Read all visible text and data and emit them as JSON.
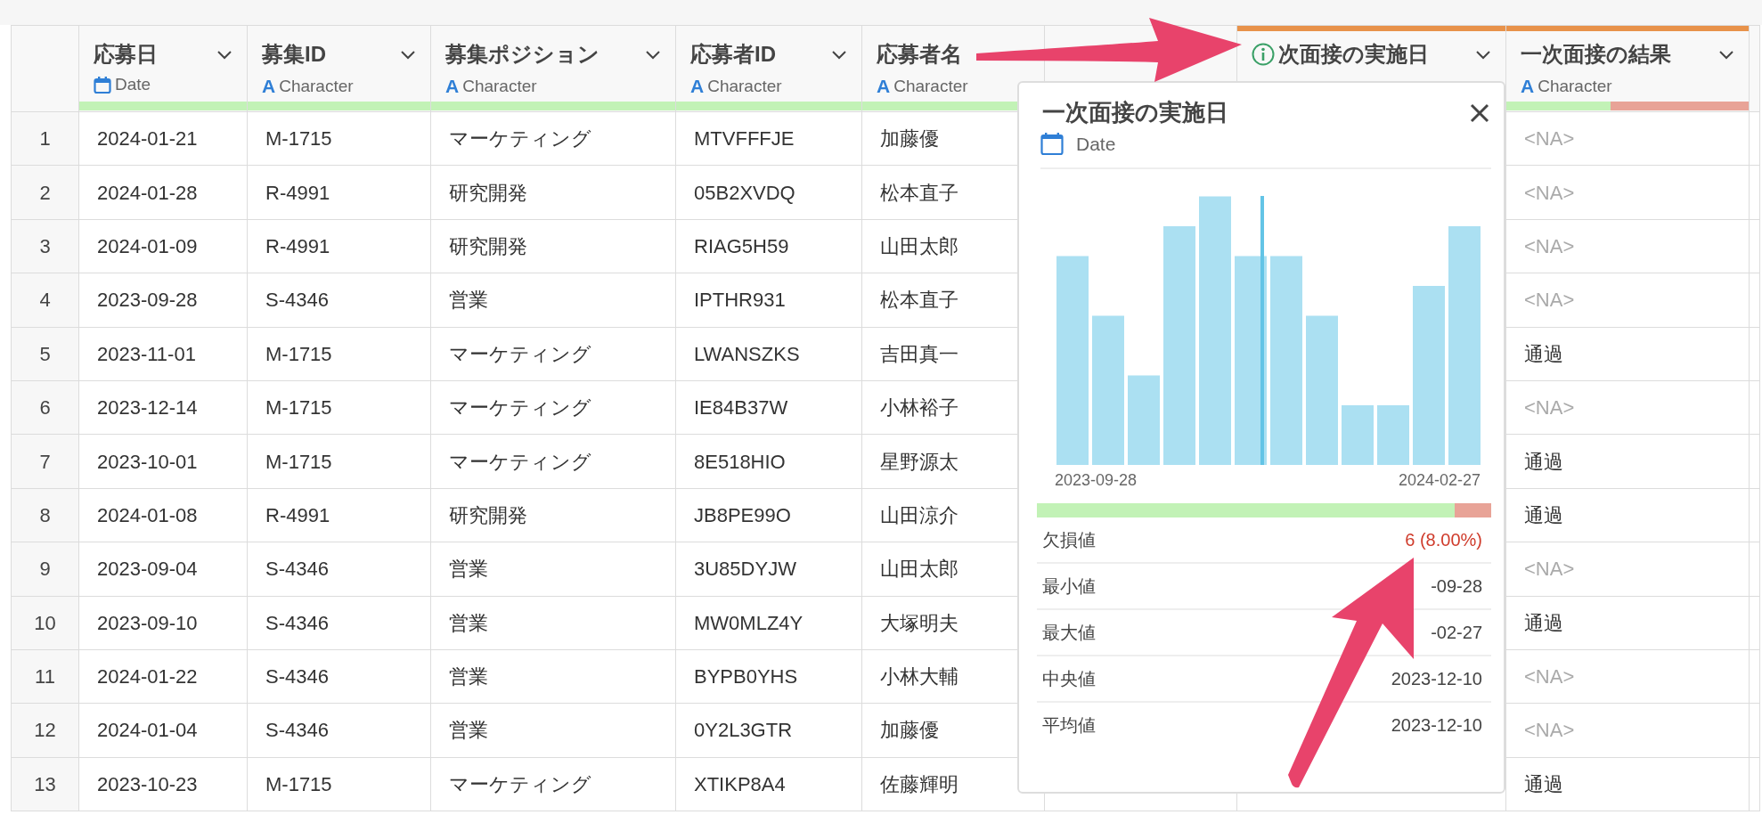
{
  "table": {
    "columns": [
      {
        "title": "応募日",
        "menu": true,
        "kind": "date",
        "type_label": "Date",
        "quality": {
          "level": 1
        },
        "highlighted": false
      },
      {
        "title": "募集ID",
        "menu": true,
        "kind": "character",
        "type_icon": "A",
        "type_label": "Character",
        "quality": {
          "level": 1
        },
        "highlighted": false
      },
      {
        "title": "募集ポジション",
        "menu": true,
        "kind": "character",
        "type_icon": "A",
        "type_label": "Character",
        "quality": {
          "level": 1
        },
        "highlighted": false
      },
      {
        "title": "応募者ID",
        "menu": true,
        "kind": "character",
        "type_icon": "A",
        "type_label": "Character",
        "quality": {
          "level": 1
        },
        "highlighted": false
      },
      {
        "title": "応募者名",
        "menu": false,
        "kind": "character",
        "type_icon": "A",
        "type_label": "Character",
        "quality": {
          "level": 1
        },
        "highlighted": false
      },
      {
        "highlighted": false
      },
      {
        "title": "次面接の実施日",
        "menu": true,
        "info": true,
        "highlighted": true
      },
      {
        "title": "一次面接の結果",
        "menu": true,
        "kind": "character",
        "type_icon": "A",
        "type_label": "Character",
        "quality": {
          "level": 0.43
        },
        "highlighted": true
      }
    ],
    "rows": [
      {
        "number": "1",
        "cells": [
          "2024-01-21",
          "M-1715",
          "マーケティング",
          "MTVFFFJE",
          "加藤優"
        ],
        "result": {
          "text": "<NA>",
          "kind": "na"
        }
      },
      {
        "number": "2",
        "cells": [
          "2024-01-28",
          "R-4991",
          "研究開発",
          "05B2XVDQ",
          "松本直子"
        ],
        "result": {
          "text": "<NA>",
          "kind": "na"
        }
      },
      {
        "number": "3",
        "cells": [
          "2024-01-09",
          "R-4991",
          "研究開発",
          "RIAG5H59",
          "山田太郎"
        ],
        "result": {
          "text": "<NA>",
          "kind": "na"
        }
      },
      {
        "number": "4",
        "cells": [
          "2023-09-28",
          "S-4346",
          "営業",
          "IPTHR931",
          "松本直子"
        ],
        "result": {
          "text": "<NA>",
          "kind": "na"
        }
      },
      {
        "number": "5",
        "cells": [
          "2023-11-01",
          "M-1715",
          "マーケティング",
          "LWANSZKS",
          "吉田真一"
        ],
        "result": {
          "text": "通過",
          "kind": "value"
        }
      },
      {
        "number": "6",
        "cells": [
          "2023-12-14",
          "M-1715",
          "マーケティング",
          "IE84B37W",
          "小林裕子"
        ],
        "result": {
          "text": "<NA>",
          "kind": "na"
        }
      },
      {
        "number": "7",
        "cells": [
          "2023-10-01",
          "M-1715",
          "マーケティング",
          "8E518HIO",
          "星野源太"
        ],
        "result": {
          "text": "通過",
          "kind": "value"
        }
      },
      {
        "number": "8",
        "cells": [
          "2024-01-08",
          "R-4991",
          "研究開発",
          "JB8PE99O",
          "山田涼介"
        ],
        "result": {
          "text": "通過",
          "kind": "value"
        }
      },
      {
        "number": "9",
        "cells": [
          "2023-09-04",
          "S-4346",
          "営業",
          "3U85DYJW",
          "山田太郎"
        ],
        "result": {
          "text": "<NA>",
          "kind": "na"
        }
      },
      {
        "number": "10",
        "cells": [
          "2023-09-10",
          "S-4346",
          "営業",
          "MW0MLZ4Y",
          "大塚明夫"
        ],
        "result": {
          "text": "通過",
          "kind": "value"
        }
      },
      {
        "number": "11",
        "cells": [
          "2024-01-22",
          "S-4346",
          "営業",
          "BYPB0YHS",
          "小林大輔"
        ],
        "result": {
          "text": "<NA>",
          "kind": "na"
        }
      },
      {
        "number": "12",
        "cells": [
          "2024-01-04",
          "S-4346",
          "営業",
          "0Y2L3GTR",
          "加藤優"
        ],
        "result": {
          "text": "<NA>",
          "kind": "na"
        }
      },
      {
        "number": "13",
        "cells": [
          "2023-10-23",
          "M-1715",
          "マーケティング",
          "XTIKP8A4",
          "佐藤輝明"
        ],
        "result": {
          "text": "通過",
          "kind": "value"
        }
      }
    ]
  },
  "popup": {
    "title": "一次面接の実施日",
    "kind": "date",
    "type_label": "Date",
    "histogram": {
      "start_label": "2023-09-28",
      "end_label": "2024-02-27"
    },
    "quality": {
      "level": 0.92
    },
    "stats": [
      {
        "label": "欠損値",
        "value": "6 (8.00%)",
        "kind": "alert"
      },
      {
        "label": "最小値",
        "value": "-09-28",
        "kind": "plain"
      },
      {
        "label": "最大値",
        "value": "-02-27",
        "kind": "plain"
      },
      {
        "label": "中央値",
        "value": "2023-12-10",
        "kind": "plain"
      },
      {
        "label": "平均値",
        "value": "2023-12-10",
        "kind": "plain"
      }
    ]
  }
}
